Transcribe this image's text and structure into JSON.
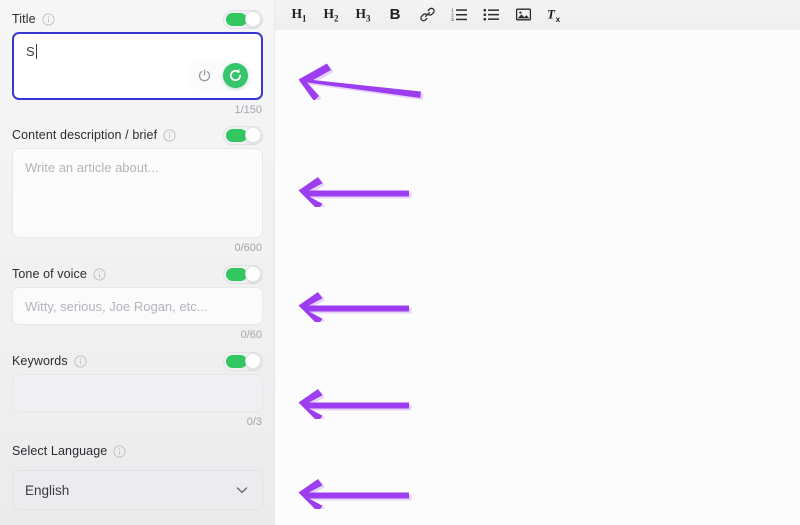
{
  "sidebar": {
    "fields": [
      {
        "id": "title",
        "label": "Title",
        "info_icon": "info-circle-icon",
        "toggle_on": true,
        "type": "text-with-actions",
        "value": "S",
        "placeholder": "",
        "counter": "1/150",
        "actions": [
          {
            "name": "power-icon",
            "label": "power"
          },
          {
            "name": "regenerate-icon",
            "label": "regenerate"
          }
        ]
      },
      {
        "id": "content_description",
        "label": "Content description / brief",
        "info_icon": "info-circle-icon",
        "toggle_on": true,
        "type": "textarea",
        "value": "",
        "placeholder": "Write an article about...",
        "counter": "0/600"
      },
      {
        "id": "tone_of_voice",
        "label": "Tone of voice",
        "info_icon": "info-circle-icon",
        "toggle_on": true,
        "type": "input",
        "value": "",
        "placeholder": "Witty, serious, Joe Rogan, etc...",
        "counter": "0/60"
      },
      {
        "id": "keywords",
        "label": "Keywords",
        "info_icon": "info-circle-icon",
        "toggle_on": true,
        "type": "input",
        "value": "",
        "placeholder": "",
        "counter": "0/3"
      },
      {
        "id": "select_language",
        "label": "Select Language",
        "info_icon": "info-circle-icon",
        "toggle_on": false,
        "type": "select",
        "value": "English",
        "options": [
          "English"
        ],
        "chevron": "chevron-down-icon"
      }
    ]
  },
  "editor": {
    "toolbar": [
      {
        "name": "heading-1-button",
        "label": "H",
        "sub": "1"
      },
      {
        "name": "heading-2-button",
        "label": "H",
        "sub": "2"
      },
      {
        "name": "heading-3-button",
        "label": "H",
        "sub": "3"
      },
      {
        "name": "bold-button",
        "label": "B",
        "sub": ""
      },
      {
        "name": "link-button",
        "label": "",
        "sub": ""
      },
      {
        "name": "ordered-list-button",
        "label": "",
        "sub": ""
      },
      {
        "name": "unordered-list-button",
        "label": "",
        "sub": ""
      },
      {
        "name": "image-button",
        "label": "",
        "sub": ""
      },
      {
        "name": "clear-formatting-button",
        "label": "",
        "sub": ""
      }
    ],
    "content": ""
  },
  "annotations": {
    "color": "#9c3df0",
    "arrows": [
      {
        "name": "annotation-arrow-title",
        "target": "title"
      },
      {
        "name": "annotation-arrow-content-description",
        "target": "content_description"
      },
      {
        "name": "annotation-arrow-tone-of-voice",
        "target": "tone_of_voice"
      },
      {
        "name": "annotation-arrow-keywords",
        "target": "keywords"
      },
      {
        "name": "annotation-arrow-select-language",
        "target": "select_language"
      }
    ]
  }
}
